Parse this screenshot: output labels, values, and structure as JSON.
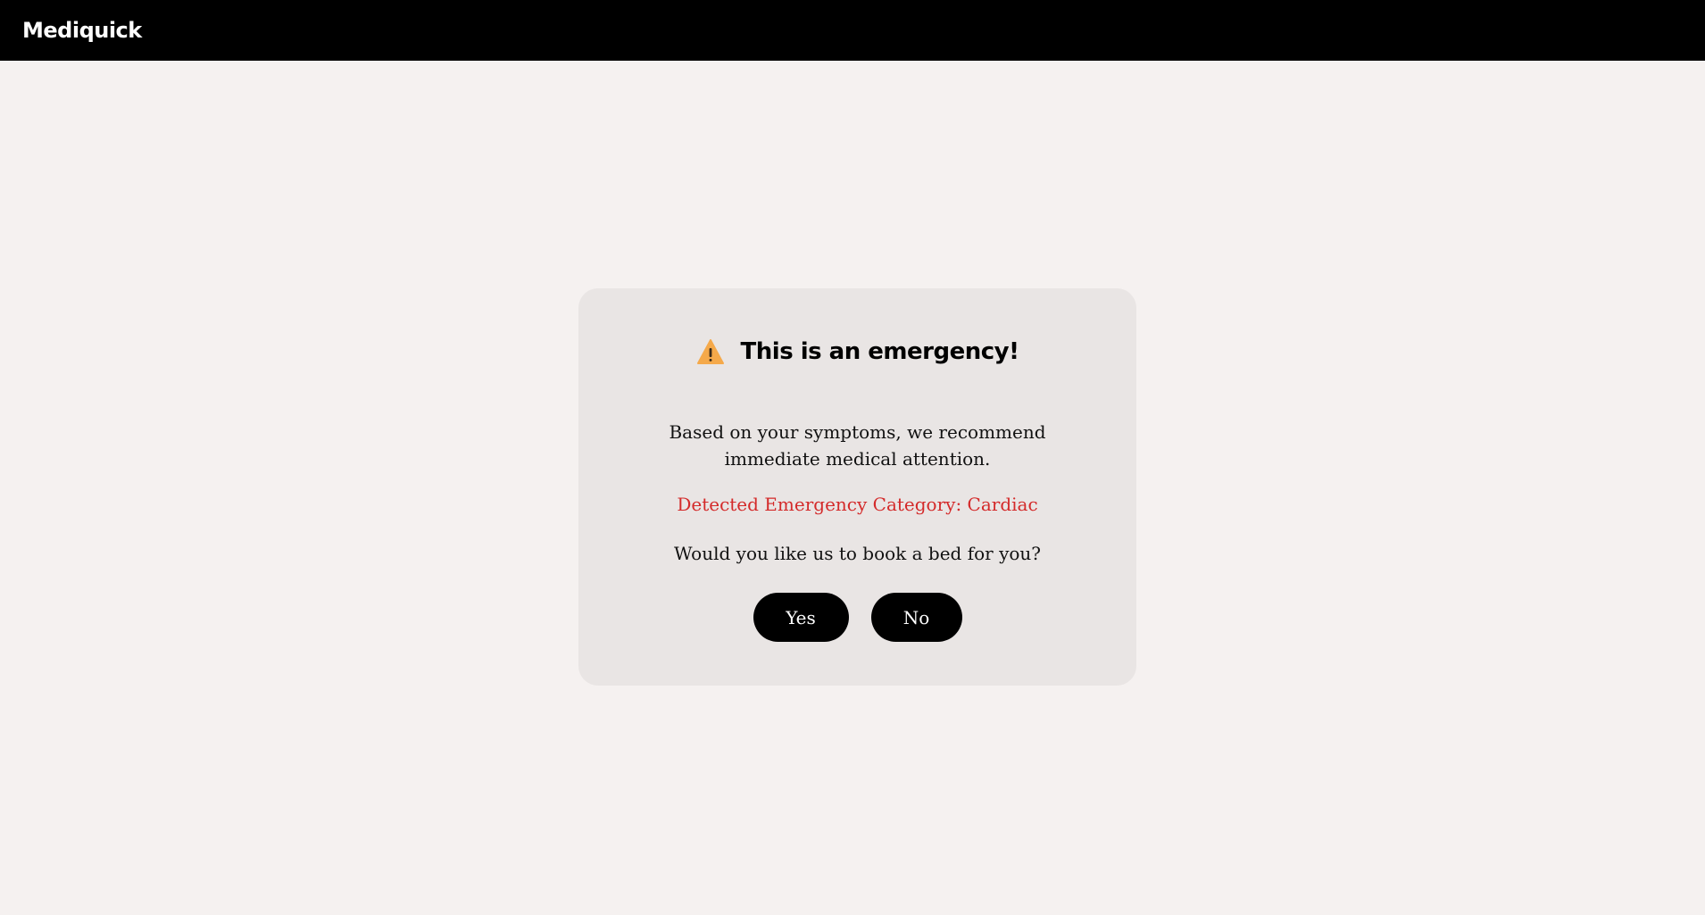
{
  "header": {
    "brand": "Mediquick",
    "background": "#000000"
  },
  "dialog": {
    "icon": "warning-icon",
    "title": "This is an emergency!",
    "message": "Based on your symptoms, we recommend immediate medical attention.",
    "category": "Detected Emergency Category: Cardiac",
    "category_color": "#d42a2a",
    "question": "Would you like us to book a bed for you?",
    "yes_label": "Yes",
    "no_label": "No"
  }
}
